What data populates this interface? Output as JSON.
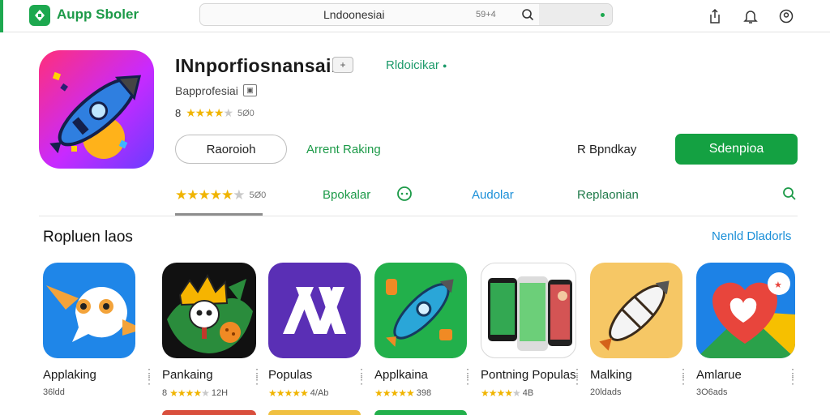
{
  "header": {
    "brand": "Aupp Sboler",
    "search_value": "Lndoonesiai",
    "search_count": "59+4"
  },
  "app": {
    "title": "INnporfiosnansaii",
    "title_chip": "+",
    "developer": "Rldoicikar",
    "subtitle": "Bapprofesiai",
    "rating_prefix": "8",
    "rating_count": "5Ø0",
    "buttons": {
      "outline": "Raoroioh",
      "ranking": "Arrent Raking",
      "rating_label": "R Bpndkay",
      "primary": "Sdenpioa"
    }
  },
  "tabs": {
    "rating_count": "5Ø0",
    "items": [
      "Bpokalar",
      "Audolar",
      "Replaonian"
    ]
  },
  "section": {
    "title": "Ropluen laos",
    "link": "Nenld Dladorls"
  },
  "apps": [
    {
      "name": "Applaking",
      "meta": "36ldd",
      "stars": 0,
      "bg": "#1f86e8"
    },
    {
      "name": "Pankaing",
      "meta_prefix": "8",
      "meta": "12H",
      "stars": 4,
      "bg": "#111111"
    },
    {
      "name": "Populas",
      "meta": "4/Ab",
      "stars": 5,
      "bg": "#5a2fb5"
    },
    {
      "name": "Applkaina",
      "meta": "398",
      "stars": 5,
      "bg": "#22b04b"
    },
    {
      "name": "Pontning Populas",
      "meta": "4B",
      "stars": 4,
      "bg": "#ffffff"
    },
    {
      "name": "Malking",
      "meta": "20ldads",
      "stars": 0,
      "bg": "#f6c765"
    },
    {
      "name": "Amlarue",
      "meta": "3O6ads",
      "stars": 0,
      "bg": "#1d82e6"
    }
  ],
  "colors": {
    "brand_green": "#1da84f",
    "primary_button": "#14a142",
    "link_blue": "#1a8fd8",
    "star": "#f0b400"
  }
}
